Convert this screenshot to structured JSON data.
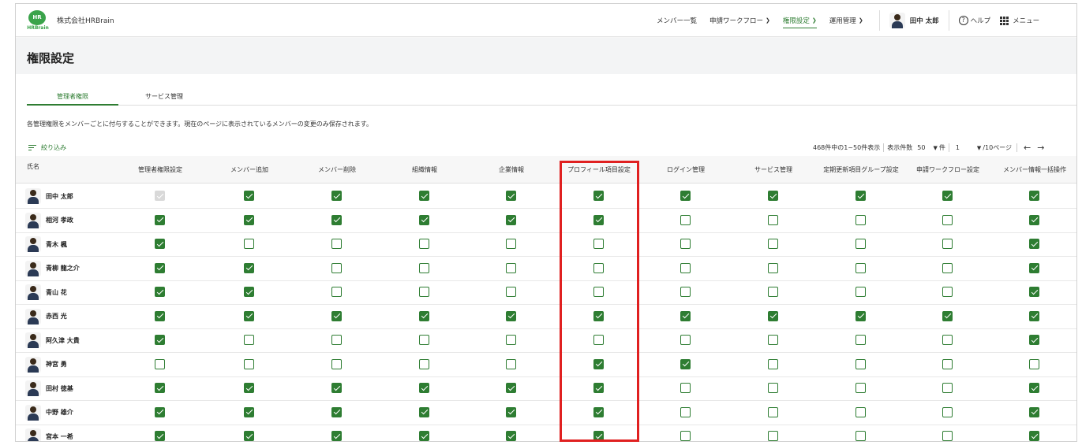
{
  "header": {
    "logo_text": "HR",
    "logo_sub": "HRBrain",
    "company": "株式会社HRBrain",
    "nav": [
      {
        "label": "メンバー一覧",
        "dropdown": false,
        "active": false
      },
      {
        "label": "申請ワークフロー",
        "dropdown": true,
        "active": false
      },
      {
        "label": "権限設定",
        "dropdown": true,
        "active": true
      },
      {
        "label": "運用管理",
        "dropdown": true,
        "active": false
      }
    ],
    "user_name": "田中 太郎",
    "help_label": "ヘルプ",
    "menu_label": "メニュー"
  },
  "page_title": "権限設定",
  "tabs": [
    {
      "label": "管理者権限",
      "active": true
    },
    {
      "label": "サービス管理",
      "active": false
    }
  ],
  "description": "各管理権限をメンバーごとに付与することができます。現在のページに表示されているメンバーの変更のみ保存されます。",
  "filter_label": "絞り込み",
  "pager": {
    "summary": "468件中の1~50件表示",
    "per_page_label": "表示件数",
    "per_page_value": "50",
    "per_page_unit": "件",
    "page_value": "1",
    "page_total": "/10ページ"
  },
  "table": {
    "name_header": "氏名",
    "columns": [
      "管理者権限設定",
      "メンバー追加",
      "メンバー削除",
      "組織情報",
      "企業情報",
      "プロフィール項目設定",
      "ログイン管理",
      "サービス管理",
      "定期更新項目グループ設定",
      "申請ワークフロー設定",
      "メンバー情報一括操作"
    ],
    "rows": [
      {
        "name": "田中 太郎",
        "checks": [
          "d",
          1,
          1,
          1,
          1,
          1,
          1,
          1,
          1,
          1,
          1
        ]
      },
      {
        "name": "相河 孝政",
        "checks": [
          1,
          1,
          1,
          1,
          1,
          1,
          0,
          0,
          0,
          0,
          1
        ]
      },
      {
        "name": "青木 楓",
        "checks": [
          1,
          0,
          0,
          0,
          0,
          0,
          0,
          0,
          0,
          0,
          1
        ]
      },
      {
        "name": "青柳 龍之介",
        "checks": [
          1,
          1,
          0,
          0,
          0,
          0,
          0,
          0,
          0,
          0,
          1
        ]
      },
      {
        "name": "青山 花",
        "checks": [
          1,
          1,
          0,
          0,
          0,
          0,
          0,
          0,
          0,
          0,
          1
        ]
      },
      {
        "name": "赤西 光",
        "checks": [
          1,
          1,
          1,
          1,
          1,
          1,
          1,
          1,
          1,
          1,
          1
        ]
      },
      {
        "name": "阿久津 大貴",
        "checks": [
          1,
          0,
          0,
          0,
          0,
          0,
          0,
          0,
          0,
          0,
          1
        ]
      },
      {
        "name": "神宮 勇",
        "checks": [
          0,
          0,
          0,
          0,
          0,
          1,
          1,
          0,
          0,
          0,
          0
        ]
      },
      {
        "name": "田村 徳基",
        "checks": [
          1,
          1,
          1,
          1,
          1,
          1,
          0,
          0,
          0,
          0,
          1
        ]
      },
      {
        "name": "中野 雄介",
        "checks": [
          1,
          1,
          1,
          1,
          1,
          1,
          0,
          0,
          0,
          0,
          1
        ]
      },
      {
        "name": "宮本 一希",
        "checks": [
          1,
          1,
          1,
          1,
          1,
          1,
          0,
          0,
          0,
          0,
          1
        ]
      }
    ]
  },
  "colors": {
    "accent": "#2e7d32",
    "highlight": "#e02020"
  }
}
